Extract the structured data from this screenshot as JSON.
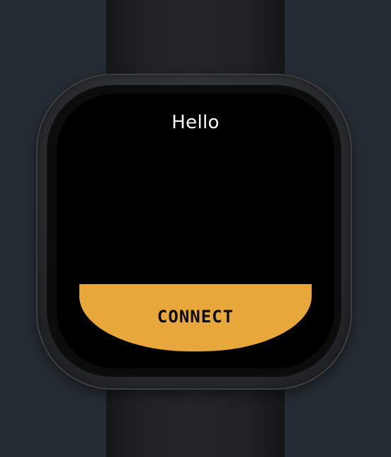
{
  "screen": {
    "greeting": "Hello",
    "primary_action_label": "CONNECT"
  },
  "colors": {
    "background": "#262c33",
    "screen": "#000000",
    "action_button": "#e8a73b",
    "action_text": "#0b0b0b",
    "greeting_text": "#ffffff"
  }
}
